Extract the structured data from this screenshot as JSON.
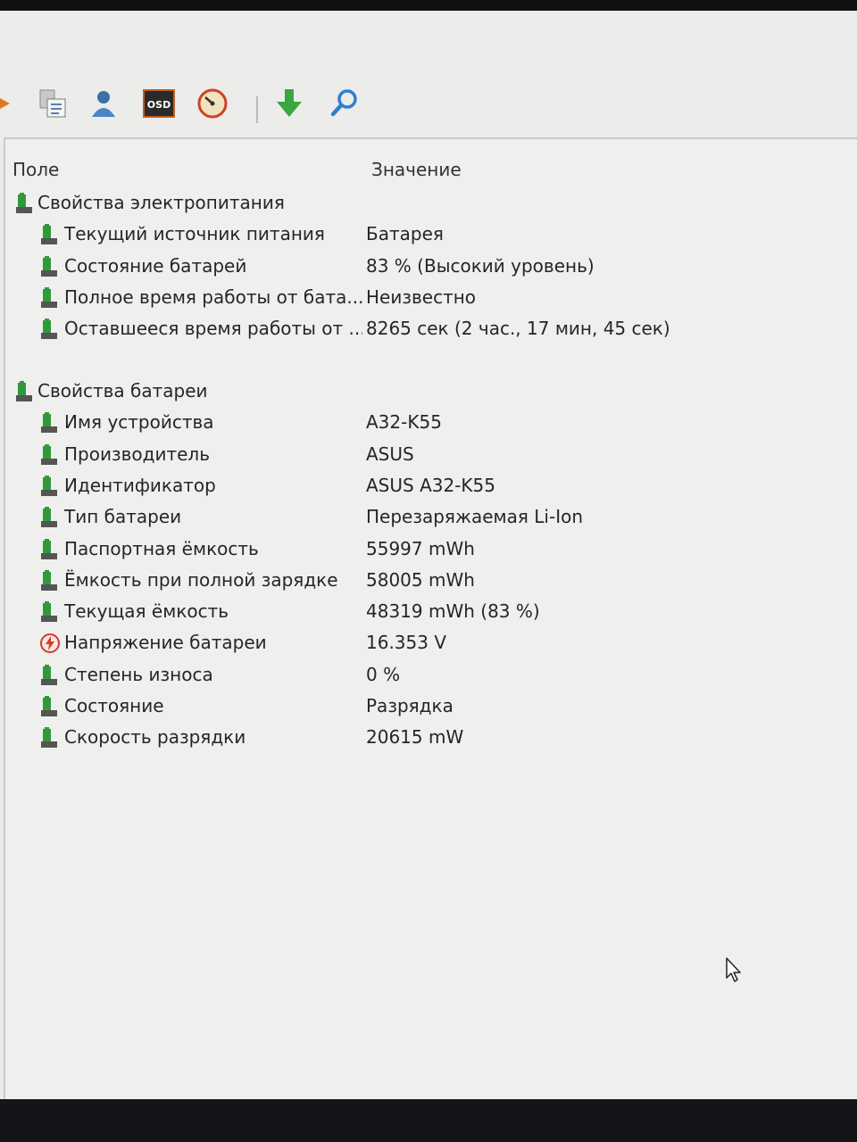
{
  "columns": {
    "field": "Поле",
    "value": "Значение"
  },
  "toolbar": {
    "icons": [
      "report-icon",
      "user-icon",
      "osd-icon",
      "gauge-icon",
      "download-icon",
      "search-icon"
    ],
    "osd_label": "OSD"
  },
  "sections": [
    {
      "title": "Свойства электропитания",
      "rows": [
        {
          "label": "Текущий источник питания",
          "value": "Батарея",
          "icon": "battery-icon"
        },
        {
          "label": "Состояние батарей",
          "value": "83 % (Высокий уровень)",
          "icon": "battery-icon"
        },
        {
          "label": "Полное время работы от бата...",
          "value": "Неизвестно",
          "icon": "battery-icon"
        },
        {
          "label": "Оставшееся время работы от ...",
          "value": "8265 сек (2 час., 17 мин, 45 сек)",
          "icon": "battery-icon"
        }
      ]
    },
    {
      "title": "Свойства батареи",
      "rows": [
        {
          "label": "Имя устройства",
          "value": "A32-K55",
          "icon": "battery-icon"
        },
        {
          "label": "Производитель",
          "value": "ASUS",
          "icon": "battery-icon"
        },
        {
          "label": "Идентификатор",
          "value": "ASUS A32-K55",
          "icon": "battery-icon"
        },
        {
          "label": "Тип батареи",
          "value": "Перезаряжаемая Li-Ion",
          "icon": "battery-icon"
        },
        {
          "label": "Паспортная ёмкость",
          "value": "55997 mWh",
          "icon": "battery-icon"
        },
        {
          "label": "Ёмкость при полной зарядке",
          "value": "58005 mWh",
          "icon": "battery-icon"
        },
        {
          "label": "Текущая ёмкость",
          "value": "48319 mWh  (83 %)",
          "icon": "battery-icon"
        },
        {
          "label": "Напряжение батареи",
          "value": "16.353 V",
          "icon": "voltage-icon"
        },
        {
          "label": "Степень износа",
          "value": "0 %",
          "icon": "battery-icon"
        },
        {
          "label": "Состояние",
          "value": "Разрядка",
          "icon": "battery-icon"
        },
        {
          "label": "Скорость разрядки",
          "value": "20615 mW",
          "icon": "battery-icon"
        }
      ]
    }
  ],
  "colors": {
    "battery_green": "#2f9a3a",
    "battery_dark": "#555555",
    "voltage_red": "#d43a2a",
    "download_green": "#3aa640",
    "search_blue": "#2f7fd0"
  }
}
